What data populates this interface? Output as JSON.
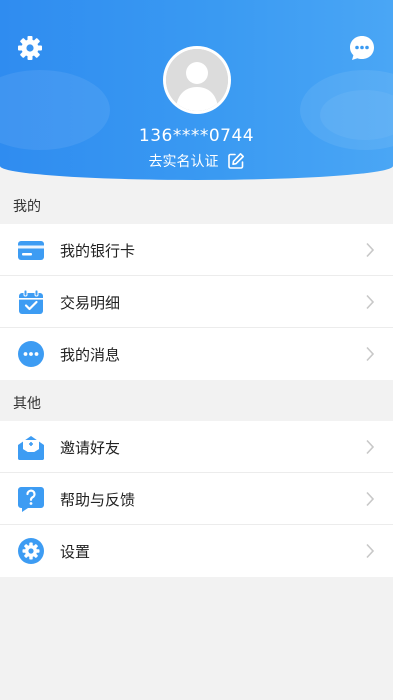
{
  "profile": {
    "phone": "136****0744",
    "verify_label": "去实名认证"
  },
  "sections": [
    {
      "title": "我的",
      "items": [
        {
          "label": "我的银行卡",
          "icon": "bank-card-icon"
        },
        {
          "label": "交易明细",
          "icon": "calendar-check-icon"
        },
        {
          "label": "我的消息",
          "icon": "message-icon"
        }
      ]
    },
    {
      "title": "其他",
      "items": [
        {
          "label": "邀请好友",
          "icon": "invite-envelope-icon"
        },
        {
          "label": "帮助与反馈",
          "icon": "help-icon"
        },
        {
          "label": "设置",
          "icon": "settings-gear-icon"
        }
      ]
    }
  ],
  "colors": {
    "accent": "#3a9af2",
    "header_gradient_start": "#2f8cf0",
    "header_gradient_end": "#4aa6f5",
    "background": "#f2f2f2"
  }
}
